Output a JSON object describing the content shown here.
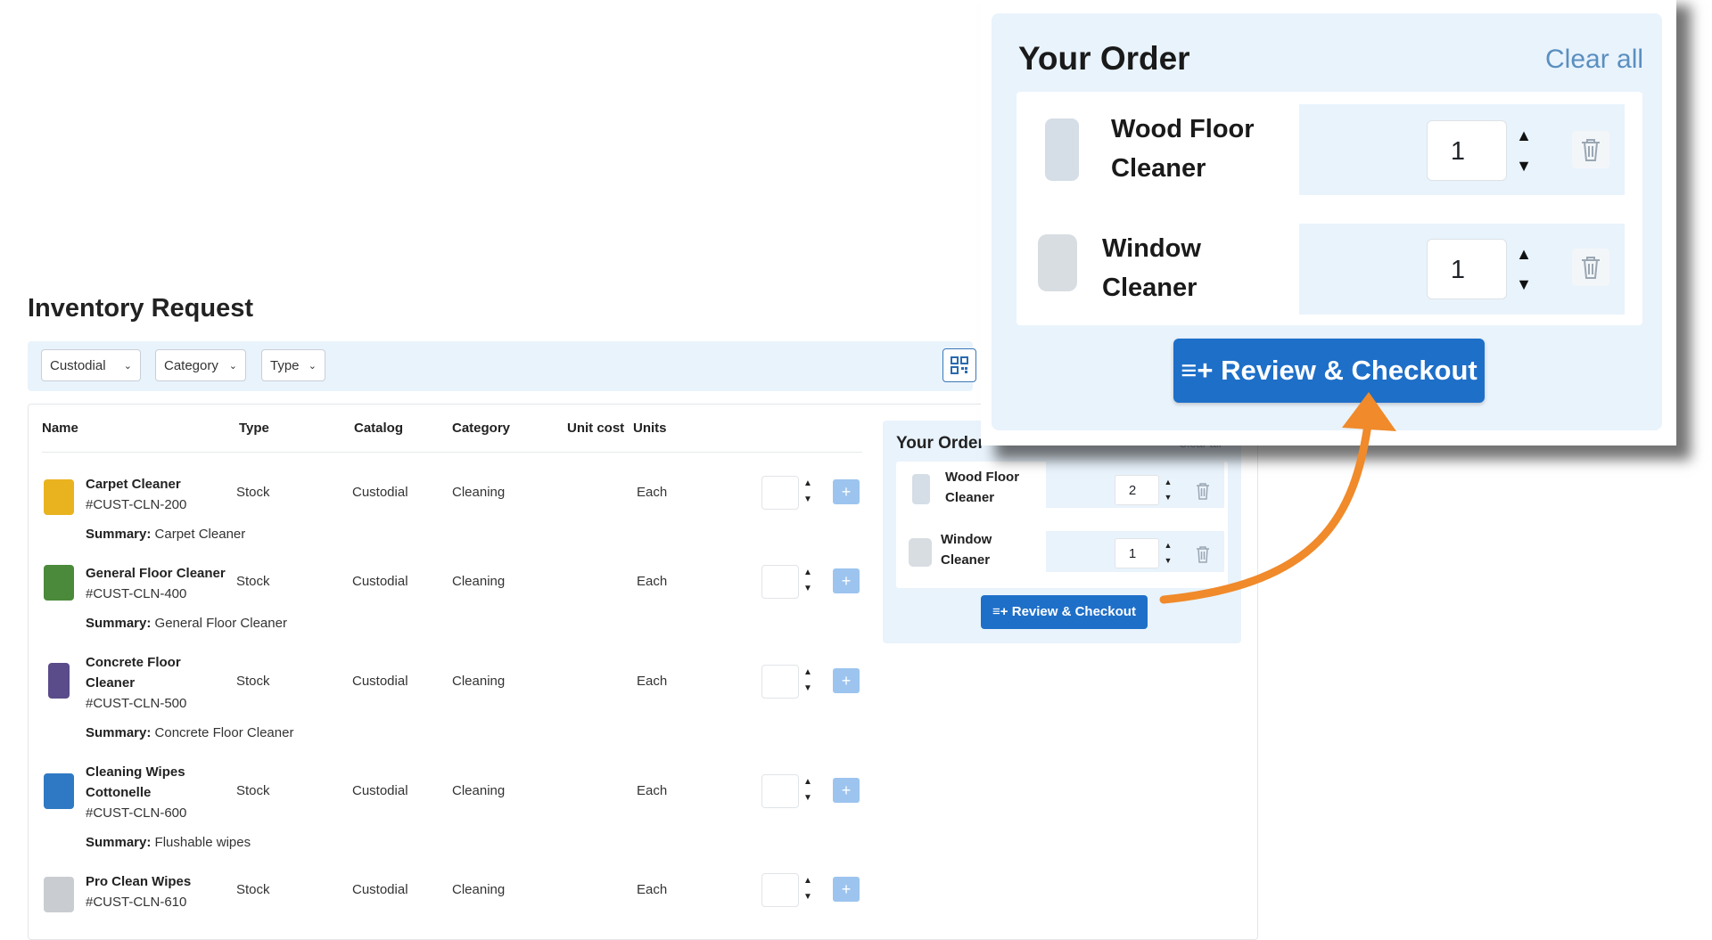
{
  "page": {
    "title": "Inventory Request"
  },
  "filters": [
    {
      "label": "Custodial"
    },
    {
      "label": "Category"
    },
    {
      "label": "Type"
    }
  ],
  "table": {
    "headers": [
      "Name",
      "Type",
      "Catalog",
      "Category",
      "Unit cost",
      "Units"
    ],
    "rows": [
      {
        "name": "Carpet Cleaner",
        "sku": "#CUST-CLN-200",
        "type": "Stock",
        "catalog": "Custodial",
        "category": "Cleaning",
        "units": "Each",
        "summary_label": "Summary:",
        "summary": "Carpet Cleaner",
        "thumb_color": "#e9b320"
      },
      {
        "name": "General Floor Cleaner",
        "sku": "#CUST-CLN-400",
        "type": "Stock",
        "catalog": "Custodial",
        "category": "Cleaning",
        "units": "Each",
        "summary_label": "Summary:",
        "summary": "General Floor Cleaner",
        "thumb_color": "#4a8a3a"
      },
      {
        "name": "Concrete Floor Cleaner",
        "sku": "#CUST-CLN-500",
        "type": "Stock",
        "catalog": "Custodial",
        "category": "Cleaning",
        "units": "Each",
        "summary_label": "Summary:",
        "summary": "Concrete Floor Cleaner",
        "thumb_color": "#5a4b8a"
      },
      {
        "name": "Cleaning Wipes Cottonelle",
        "sku": "#CUST-CLN-600",
        "type": "Stock",
        "catalog": "Custodial",
        "category": "Cleaning",
        "units": "Each",
        "summary_label": "Summary:",
        "summary": "Flushable wipes",
        "thumb_color": "#2f79c4"
      },
      {
        "name": "Pro Clean Wipes",
        "sku": "#CUST-CLN-610",
        "type": "Stock",
        "catalog": "Custodial",
        "category": "Cleaning",
        "units": "Each",
        "thumb_color": "#c9cdd2"
      }
    ]
  },
  "order_panel": {
    "title": "Your Order",
    "clear_label": "Clear all",
    "items": [
      {
        "name_line1": "Wood Floor",
        "name_line2": "Cleaner",
        "qty": "2"
      },
      {
        "name_line1": "Window",
        "name_line2": "Cleaner",
        "qty": "1"
      }
    ],
    "checkout_label": "Review & Checkout"
  },
  "zoom_panel": {
    "title": "Your Order",
    "clear_label": "Clear all",
    "items": [
      {
        "name_line1": "Wood Floor",
        "name_line2": "Cleaner",
        "qty": "1"
      },
      {
        "name_line1": "Window",
        "name_line2": "Cleaner",
        "qty": "1"
      }
    ],
    "checkout_label": "Review & Checkout"
  },
  "icons": {
    "chevron": "chevron-down-icon",
    "qr": "qr-code-icon",
    "trash": "trash-icon",
    "plus": "plus-icon",
    "checkout": "list-add-icon"
  },
  "colors": {
    "accent": "#1e6fc8",
    "panel_bg": "#e9f3fc",
    "add_btn": "#9cc4ee",
    "arrow": "#f08a2a"
  }
}
